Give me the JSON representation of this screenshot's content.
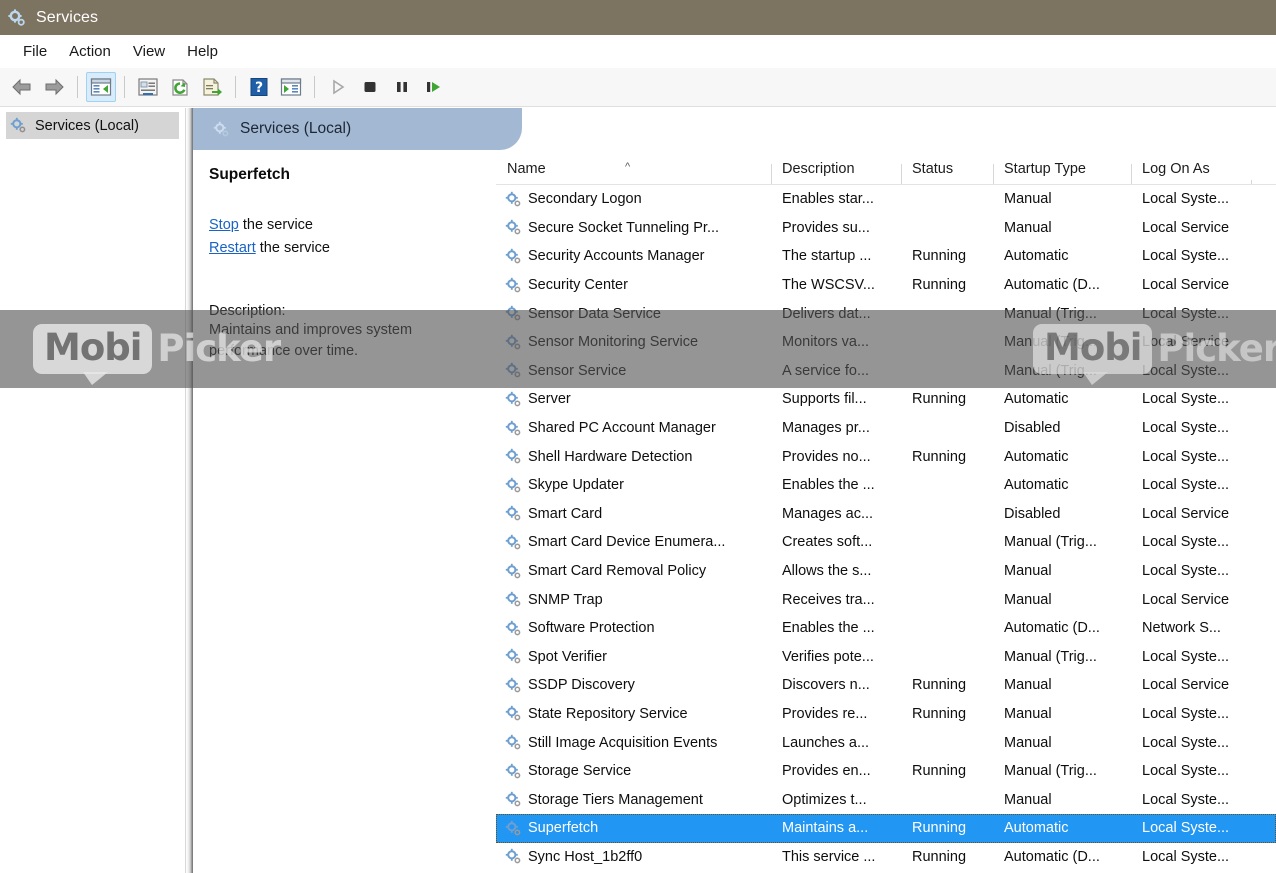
{
  "window": {
    "title": "Services",
    "icon": "services-gear-icon"
  },
  "menu": {
    "items": [
      {
        "label": "File"
      },
      {
        "label": "Action"
      },
      {
        "label": "View"
      },
      {
        "label": "Help"
      }
    ]
  },
  "toolbar": {
    "buttons": [
      {
        "name": "back-icon",
        "active": false
      },
      {
        "name": "forward-icon",
        "active": false
      },
      {
        "name": "show-hide-tree-icon",
        "active": true
      },
      {
        "name": "properties-icon",
        "active": false
      },
      {
        "name": "refresh-icon",
        "active": false
      },
      {
        "name": "export-list-icon",
        "active": false
      },
      {
        "name": "help-icon",
        "active": false
      },
      {
        "name": "show-action-pane-icon",
        "active": false
      },
      {
        "name": "start-service-icon",
        "active": false
      },
      {
        "name": "stop-service-icon",
        "active": false
      },
      {
        "name": "pause-service-icon",
        "active": false
      },
      {
        "name": "restart-service-icon",
        "active": false
      }
    ]
  },
  "tree": {
    "items": [
      {
        "label": "Services (Local)",
        "selected": true
      }
    ]
  },
  "pane_header": {
    "label": "Services (Local)"
  },
  "detail": {
    "service_name": "Superfetch",
    "links": [
      {
        "link_text": "Stop",
        "rest_text": " the service"
      },
      {
        "link_text": "Restart",
        "rest_text": " the service"
      }
    ],
    "description_label": "Description:",
    "description_text": "Maintains and improves system performance over time."
  },
  "list": {
    "columns": [
      {
        "label": "Name",
        "sorted": "asc"
      },
      {
        "label": "Description",
        "sorted": ""
      },
      {
        "label": "Status",
        "sorted": ""
      },
      {
        "label": "Startup Type",
        "sorted": ""
      },
      {
        "label": "Log On As",
        "sorted": ""
      }
    ],
    "rows": [
      {
        "name": "Secondary Logon",
        "description": "Enables star...",
        "status": "",
        "startup": "Manual",
        "logon": "Local Syste...",
        "selected": false
      },
      {
        "name": "Secure Socket Tunneling Pr...",
        "description": "Provides su...",
        "status": "",
        "startup": "Manual",
        "logon": "Local Service",
        "selected": false
      },
      {
        "name": "Security Accounts Manager",
        "description": "The startup ...",
        "status": "Running",
        "startup": "Automatic",
        "logon": "Local Syste...",
        "selected": false
      },
      {
        "name": "Security Center",
        "description": "The WSCSV...",
        "status": "Running",
        "startup": "Automatic (D...",
        "logon": "Local Service",
        "selected": false
      },
      {
        "name": "Sensor Data Service",
        "description": "Delivers dat...",
        "status": "",
        "startup": "Manual (Trig...",
        "logon": "Local Syste...",
        "selected": false
      },
      {
        "name": "Sensor Monitoring Service",
        "description": "Monitors va...",
        "status": "",
        "startup": "Manual (Trig...",
        "logon": "Local Service",
        "selected": false
      },
      {
        "name": "Sensor Service",
        "description": "A service fo...",
        "status": "",
        "startup": "Manual (Trig...",
        "logon": "Local Syste...",
        "selected": false
      },
      {
        "name": "Server",
        "description": "Supports fil...",
        "status": "Running",
        "startup": "Automatic",
        "logon": "Local Syste...",
        "selected": false
      },
      {
        "name": "Shared PC Account Manager",
        "description": "Manages pr...",
        "status": "",
        "startup": "Disabled",
        "logon": "Local Syste...",
        "selected": false
      },
      {
        "name": "Shell Hardware Detection",
        "description": "Provides no...",
        "status": "Running",
        "startup": "Automatic",
        "logon": "Local Syste...",
        "selected": false
      },
      {
        "name": "Skype Updater",
        "description": "Enables the ...",
        "status": "",
        "startup": "Automatic",
        "logon": "Local Syste...",
        "selected": false
      },
      {
        "name": "Smart Card",
        "description": "Manages ac...",
        "status": "",
        "startup": "Disabled",
        "logon": "Local Service",
        "selected": false
      },
      {
        "name": "Smart Card Device Enumera...",
        "description": "Creates soft...",
        "status": "",
        "startup": "Manual (Trig...",
        "logon": "Local Syste...",
        "selected": false
      },
      {
        "name": "Smart Card Removal Policy",
        "description": "Allows the s...",
        "status": "",
        "startup": "Manual",
        "logon": "Local Syste...",
        "selected": false
      },
      {
        "name": "SNMP Trap",
        "description": "Receives tra...",
        "status": "",
        "startup": "Manual",
        "logon": "Local Service",
        "selected": false
      },
      {
        "name": "Software Protection",
        "description": "Enables the ...",
        "status": "",
        "startup": "Automatic (D...",
        "logon": "Network S...",
        "selected": false
      },
      {
        "name": "Spot Verifier",
        "description": "Verifies pote...",
        "status": "",
        "startup": "Manual (Trig...",
        "logon": "Local Syste...",
        "selected": false
      },
      {
        "name": "SSDP Discovery",
        "description": "Discovers n...",
        "status": "Running",
        "startup": "Manual",
        "logon": "Local Service",
        "selected": false
      },
      {
        "name": "State Repository Service",
        "description": "Provides re...",
        "status": "Running",
        "startup": "Manual",
        "logon": "Local Syste...",
        "selected": false
      },
      {
        "name": "Still Image Acquisition Events",
        "description": "Launches a...",
        "status": "",
        "startup": "Manual",
        "logon": "Local Syste...",
        "selected": false
      },
      {
        "name": "Storage Service",
        "description": "Provides en...",
        "status": "Running",
        "startup": "Manual (Trig...",
        "logon": "Local Syste...",
        "selected": false
      },
      {
        "name": "Storage Tiers Management",
        "description": "Optimizes t...",
        "status": "",
        "startup": "Manual",
        "logon": "Local Syste...",
        "selected": false
      },
      {
        "name": "Superfetch",
        "description": "Maintains a...",
        "status": "Running",
        "startup": "Automatic",
        "logon": "Local Syste...",
        "selected": true
      },
      {
        "name": "Sync Host_1b2ff0",
        "description": "This service ...",
        "status": "Running",
        "startup": "Automatic (D...",
        "logon": "Local Syste...",
        "selected": false
      }
    ]
  },
  "watermark": {
    "part_one": "Mobi",
    "part_two": "Picker"
  },
  "colors": {
    "titlebar": "#7d7361",
    "pane_header": "#a3b8d3",
    "selection": "#2196f3",
    "link": "#1a63c4"
  }
}
